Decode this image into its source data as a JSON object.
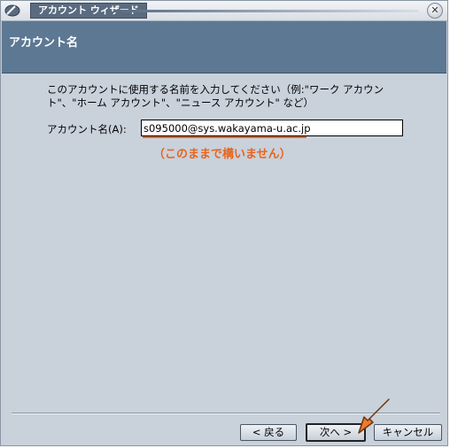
{
  "window": {
    "title": "アカウント ウィザード"
  },
  "header": {
    "title": "アカウント名"
  },
  "main": {
    "description": "このアカウントに使用する名前を入力してください（例:\"ワーク アカウント\"、\"ホーム アカウント\"、\"ニュース アカウント\" など）",
    "field_label": "アカウント名(A):",
    "field_value": "s095000@sys.wakayama-u.ac.jp",
    "annotation": "（このままで構いません）"
  },
  "footer": {
    "back_label": "< 戻る",
    "next_label": "次へ >",
    "cancel_label": "キャンセル"
  },
  "colors": {
    "header_bg": "#5d7893",
    "window_bg": "#c9d1db",
    "annotation": "#e8641c"
  },
  "icons": [
    "app-icon",
    "close-icon",
    "arrow-pointer-icon"
  ]
}
